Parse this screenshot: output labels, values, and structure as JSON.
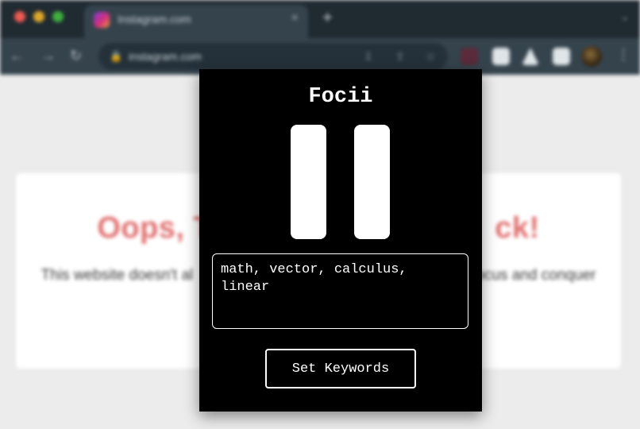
{
  "browser": {
    "tab": {
      "title": "Instagram.com",
      "icon": "instagram-logo-icon",
      "close_label": "×"
    },
    "new_tab_label": "+",
    "tab_menu_label": "⌄",
    "nav": {
      "back": "←",
      "forward": "→",
      "reload": "↻"
    },
    "address_bar": {
      "url": "instagram.com",
      "lock": "🔒"
    },
    "menu_label": "⋮"
  },
  "blocked_page": {
    "title_left": "Oops, T",
    "title_right": "ck!",
    "subtitle_left": "This website doesn't al",
    "subtitle_right": "ocus and conquer"
  },
  "popup": {
    "title": "Focii",
    "state_icon": "pause-icon",
    "keywords_value": "math, vector, calculus, linear",
    "set_button_label": "Set Keywords"
  },
  "colors": {
    "popup_bg": "#000000",
    "popup_fg": "#ffffff",
    "blocked_title": "#e07070",
    "browser_chrome": "#35434d"
  }
}
